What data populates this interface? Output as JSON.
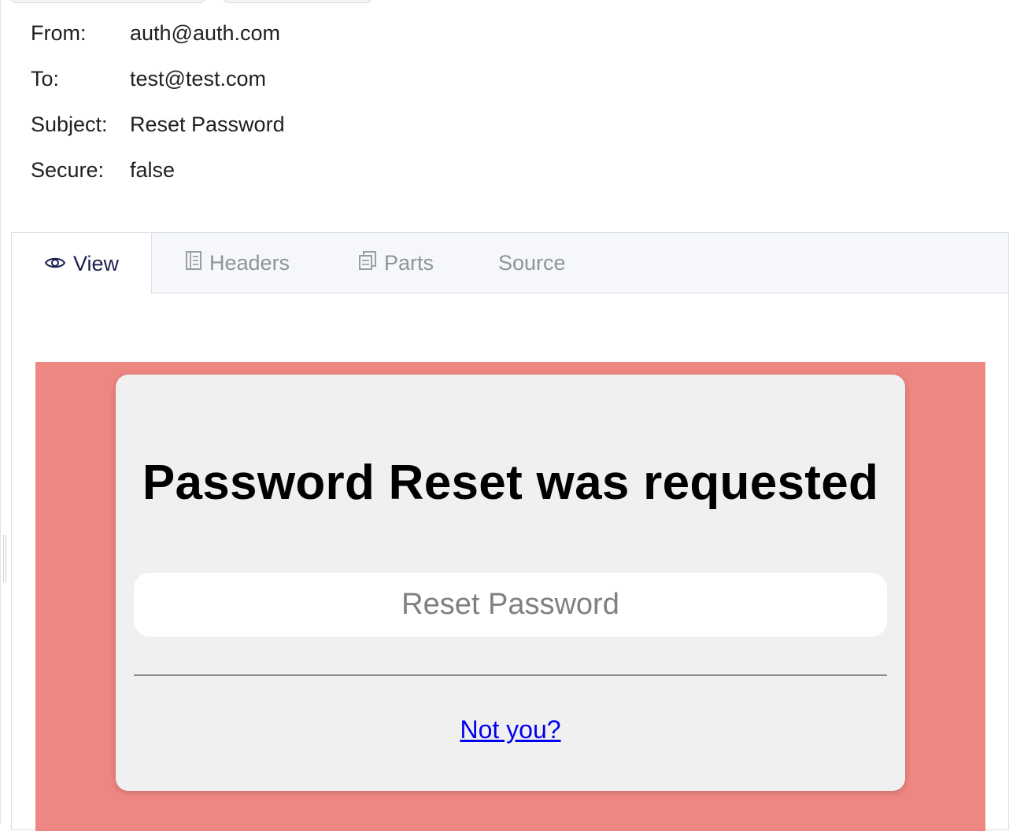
{
  "email": {
    "fields": [
      {
        "label": "From:",
        "value": "auth@auth.com"
      },
      {
        "label": "To:",
        "value": "test@test.com"
      },
      {
        "label": "Subject:",
        "value": "Reset Password"
      },
      {
        "label": "Secure:",
        "value": "false"
      }
    ]
  },
  "tabs": {
    "view": {
      "label": "View",
      "icon": "eye-icon"
    },
    "headers": {
      "label": "Headers",
      "icon": "document-icon"
    },
    "parts": {
      "label": "Parts",
      "icon": "copy-icon"
    },
    "source": {
      "label": "Source"
    }
  },
  "message": {
    "background_color": "#ee8682",
    "card_color": "#f0f0f0",
    "title": "Password Reset was requested",
    "button_label": "Reset Password",
    "link_label": "Not you?",
    "link_color": "#0000ee"
  }
}
